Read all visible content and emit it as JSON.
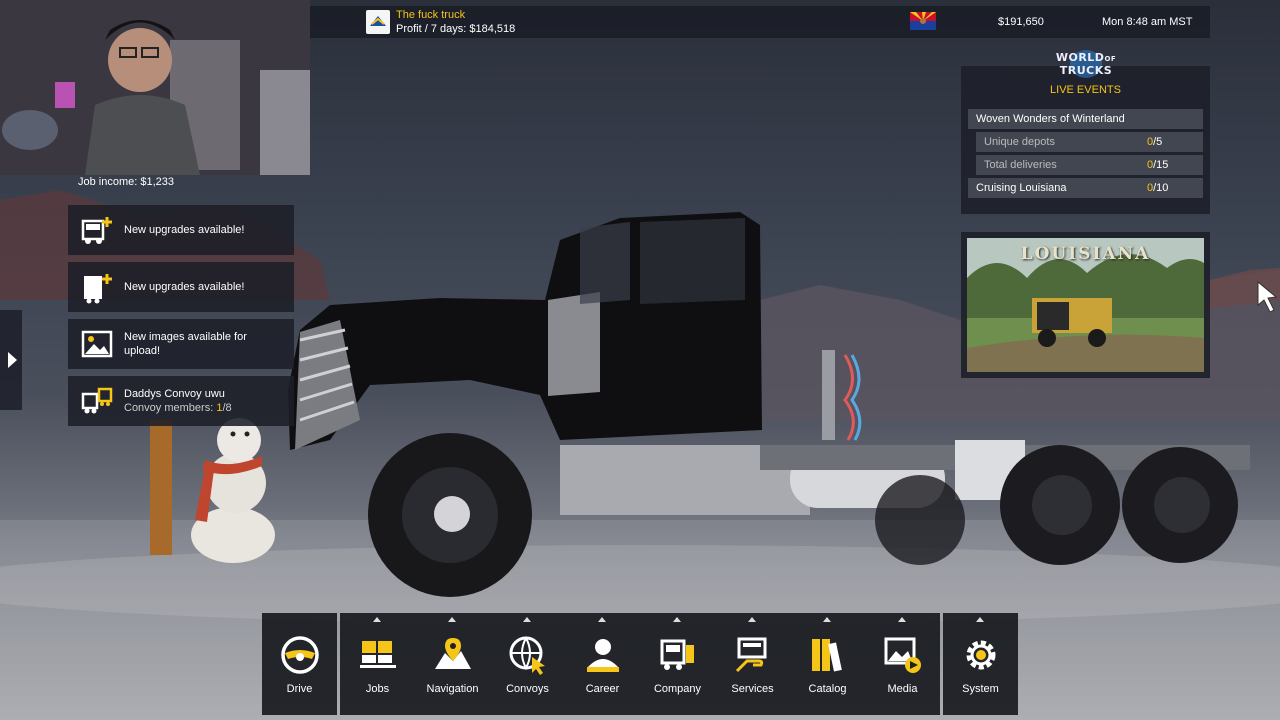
{
  "topbar": {
    "company_name": "The fuck truck",
    "profit_text": "Profit / 7 days: $184,518",
    "money": "$191,650",
    "clock": "Mon 8:48 am MST"
  },
  "job_income": {
    "label": "Job income:",
    "value": "$1,233"
  },
  "notifications": [
    {
      "text": "New upgrades available!",
      "icon": "truck-plus-icon"
    },
    {
      "text": "New upgrades available!",
      "icon": "trailer-plus-icon"
    },
    {
      "text": "New images available for upload!",
      "icon": "image-icon"
    },
    {
      "text": "Daddys Convoy uwu",
      "sub_label": "Convoy members: ",
      "sub_current": "1",
      "sub_total": "/8",
      "icon": "convoy-icon"
    }
  ],
  "world_of_trucks": {
    "logo_line1": "WORLD",
    "logo_line2": "TRUCKS",
    "logo_of": "OF",
    "live_events_label": "LIVE EVENTS",
    "events": [
      {
        "title": "Woven Wonders of Winterland",
        "indent": false
      },
      {
        "title": "Unique depots",
        "current": "0",
        "total": "/5",
        "indent": true
      },
      {
        "title": "Total deliveries",
        "current": "0",
        "total": "/15",
        "indent": true
      },
      {
        "title": "Cruising Louisiana",
        "current": "0",
        "total": "/10",
        "indent": false
      }
    ],
    "promo_title": "LOUISIANA"
  },
  "menu": {
    "drive": "Drive",
    "items": [
      "Jobs",
      "Navigation",
      "Convoys",
      "Career",
      "Company",
      "Services",
      "Catalog",
      "Media"
    ],
    "system": "System"
  },
  "colors": {
    "accent": "#f5c518",
    "panel": "#1c1f28"
  }
}
